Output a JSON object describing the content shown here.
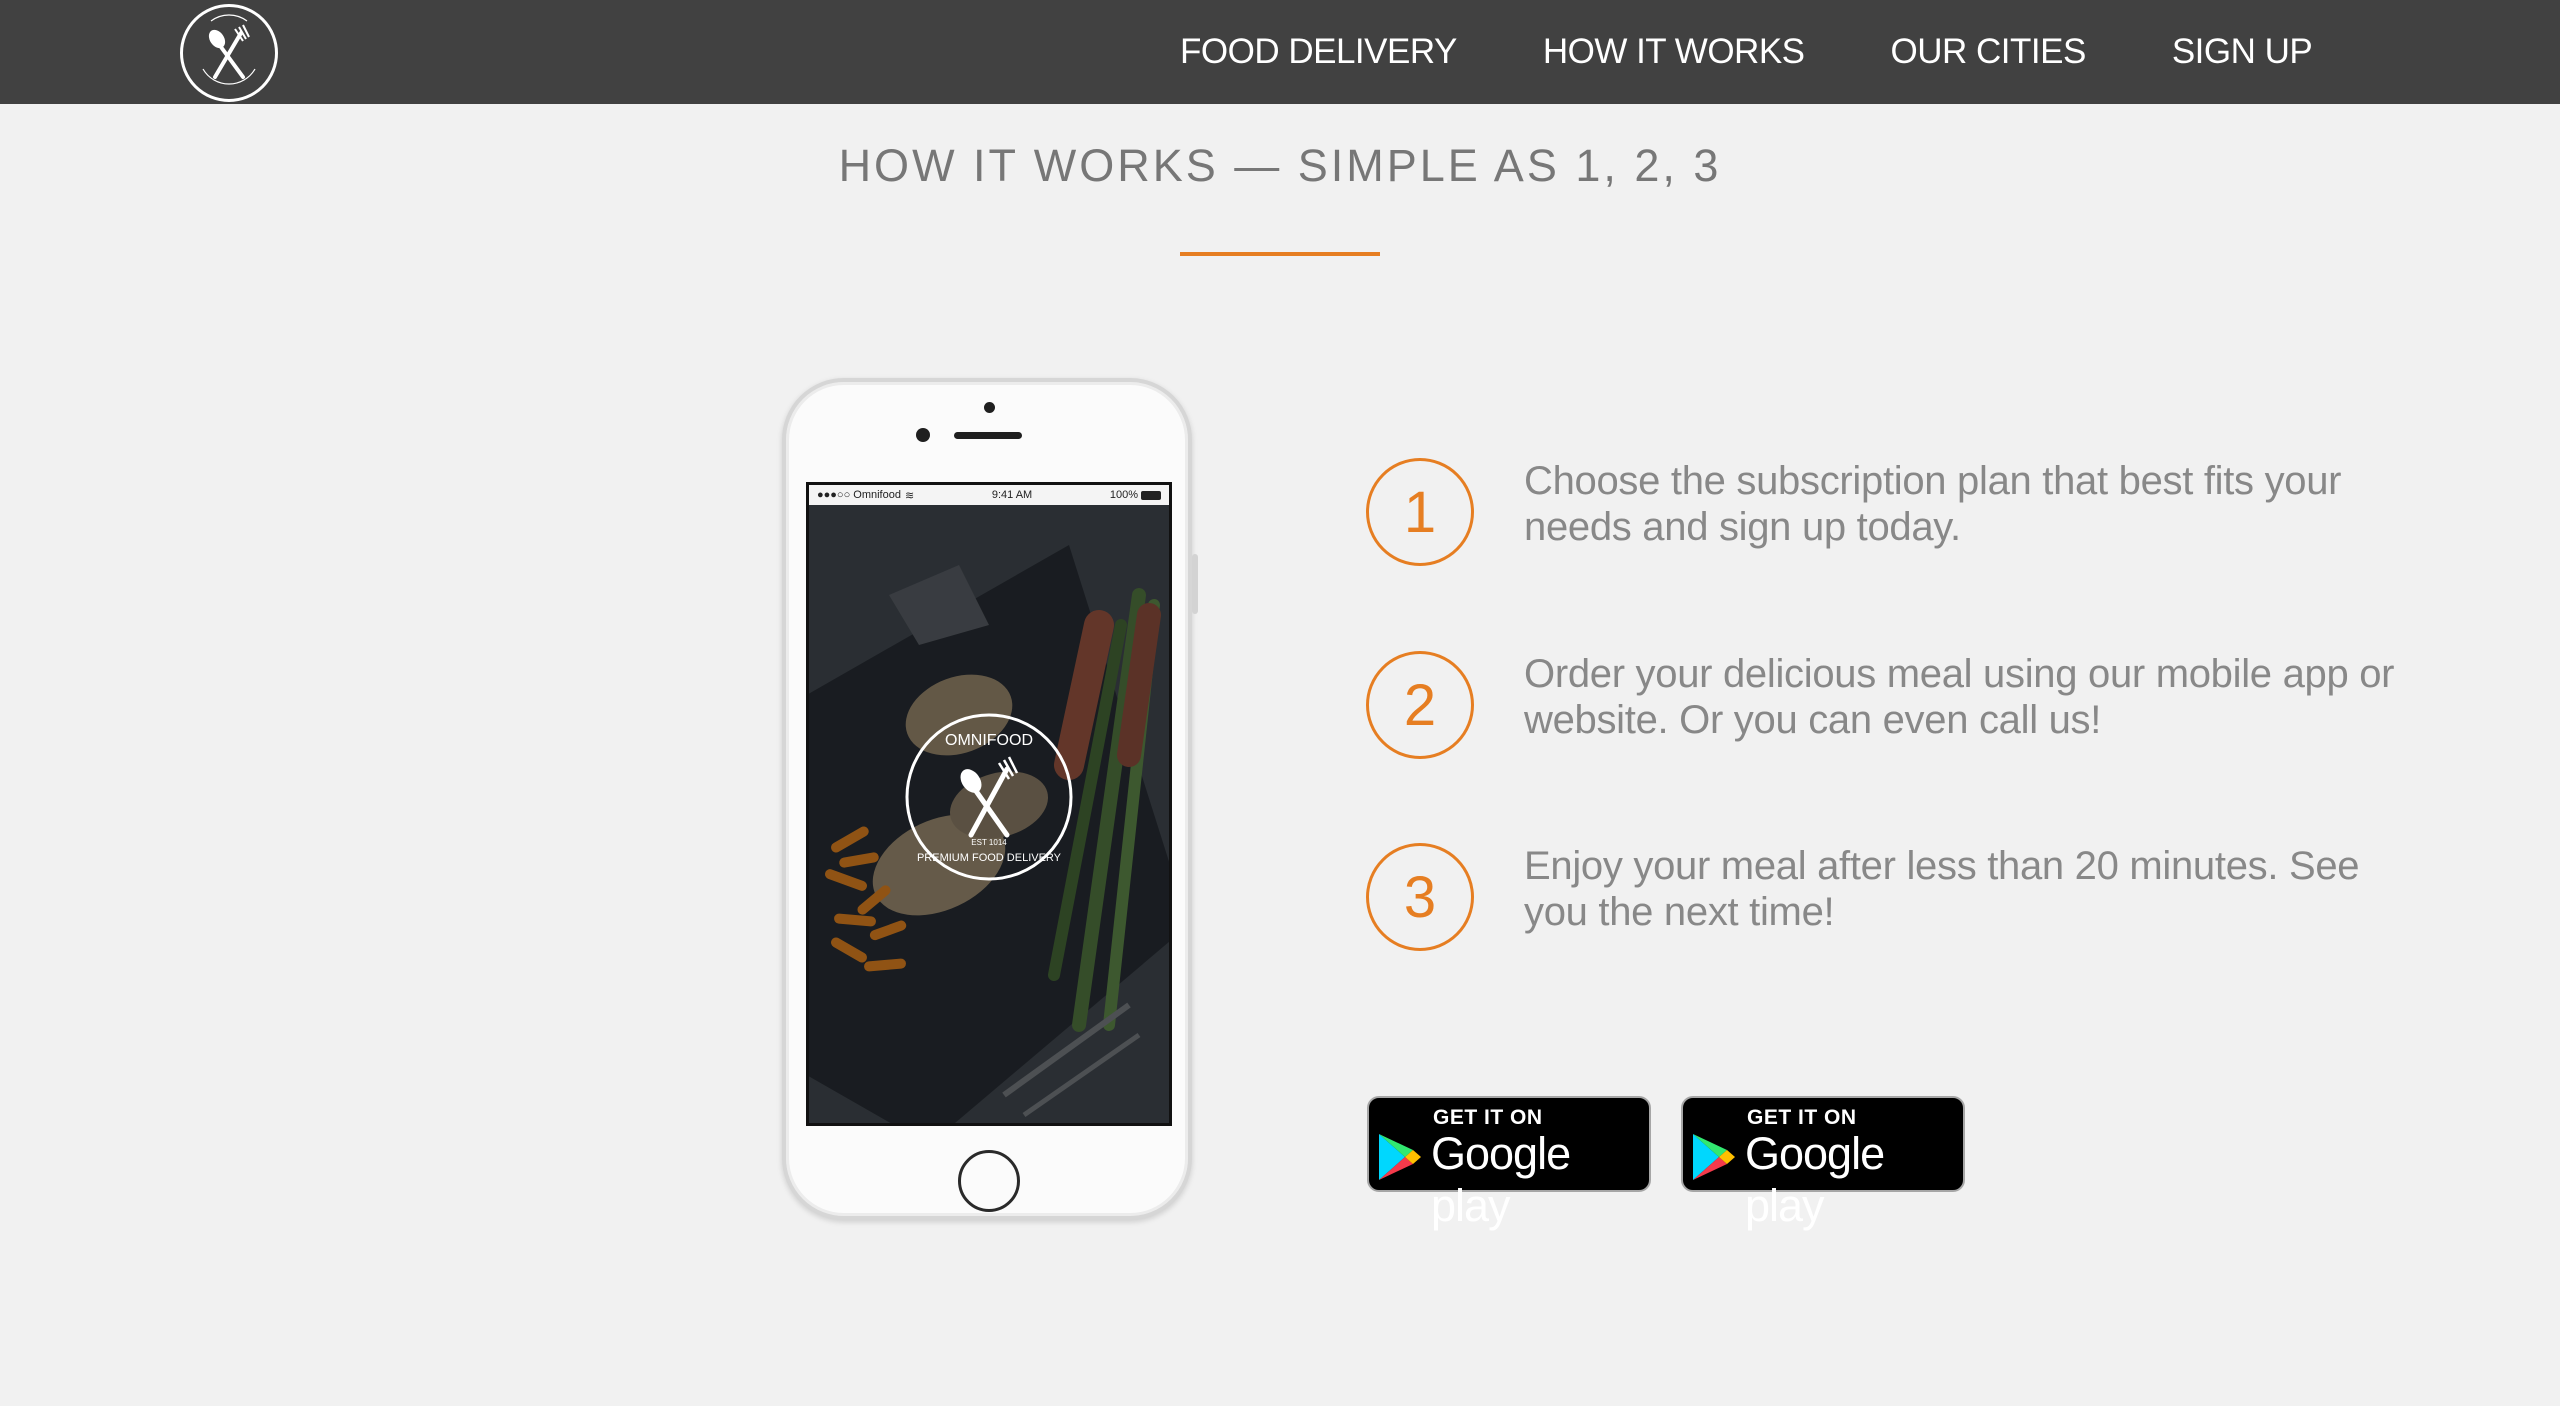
{
  "nav": {
    "logo_alt": "Omnifood",
    "links": [
      {
        "label": "FOOD DELIVERY"
      },
      {
        "label": "HOW IT WORKS"
      },
      {
        "label": "OUR CITIES"
      },
      {
        "label": "SIGN UP"
      }
    ]
  },
  "section": {
    "title": "HOW IT WORKS — SIMPLE AS 1, 2, 3"
  },
  "phone": {
    "status_carrier": "●●●○○ Omnifood",
    "status_time": "9:41 AM",
    "status_battery": "100%",
    "app_logo_top": "OMNIFOOD",
    "app_logo_est": "EST 1014",
    "app_logo_bottom": "PREMIUM FOOD DELIVERY"
  },
  "steps": [
    {
      "number": "1",
      "text": "Choose the subscription plan that best fits your needs and sign up today."
    },
    {
      "number": "2",
      "text": "Order your delicious meal using our mobile app or website. Or you can even call us!"
    },
    {
      "number": "3",
      "text": "Enjoy your meal after less than 20 minutes. See you the next time!"
    }
  ],
  "badges": [
    {
      "top": "GET IT ON",
      "main": "Google play"
    },
    {
      "top": "GET IT ON",
      "main": "Google play"
    }
  ],
  "colors": {
    "accent": "#e67e22",
    "nav_bg": "#414141",
    "page_bg": "#f1f1f1",
    "text_gray": "#888888"
  }
}
